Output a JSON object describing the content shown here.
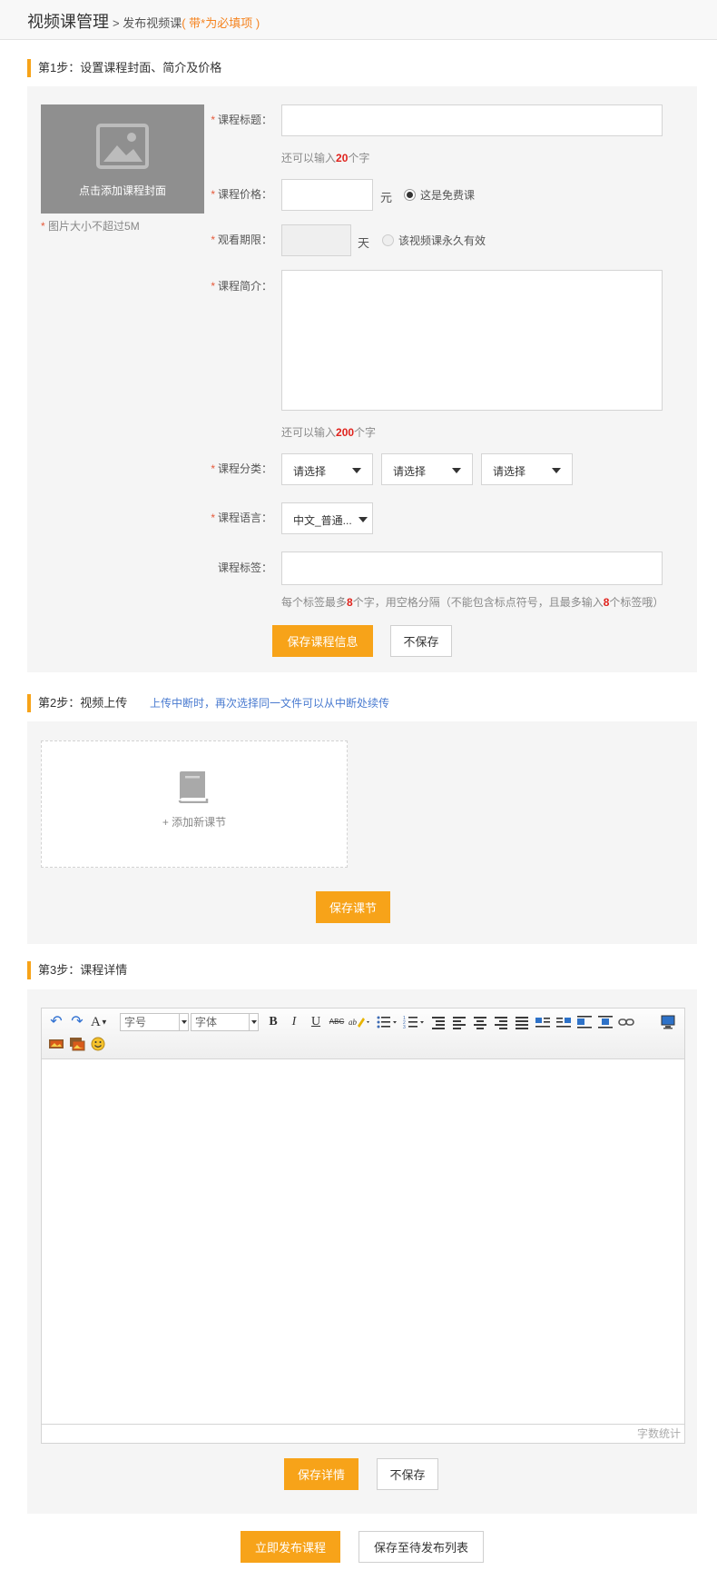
{
  "header": {
    "title": "视频课管理",
    "separator": ">",
    "crumb": "发布视频课",
    "required_note": "( 带*为必填项 )"
  },
  "step1": {
    "title": "第1步：设置课程封面、简介及价格",
    "cover": {
      "label": "点击添加课程封面",
      "note_star": "*",
      "note": "图片大小不超过5M"
    },
    "title_field": {
      "star": "*",
      "label": "课程标题：",
      "value": "",
      "hint_prefix": "还可以输入",
      "hint_count": "20",
      "hint_suffix": "个字"
    },
    "price_field": {
      "star": "*",
      "label": "课程价格：",
      "value": "",
      "unit": "元",
      "free_label": "这是免费课",
      "free_checked": true
    },
    "period_field": {
      "star": "*",
      "label": "观看期限：",
      "value": "",
      "unit": "天",
      "forever_label": "该视频课永久有效",
      "forever_checked": false
    },
    "intro_field": {
      "star": "*",
      "label": "课程简介：",
      "value": "",
      "hint_prefix": "还可以输入",
      "hint_count": "200",
      "hint_suffix": "个字"
    },
    "category_field": {
      "star": "*",
      "label": "课程分类：",
      "selects": [
        "请选择",
        "请选择",
        "请选择"
      ]
    },
    "language_field": {
      "star": "*",
      "label": "课程语言：",
      "selected": "中文_普通..."
    },
    "tags_field": {
      "label": "课程标签：",
      "value": "",
      "hint_a": "每个标签最多",
      "hint_n1": "8",
      "hint_b": "个字，用空格分隔（不能包含标点符号，且最多输入",
      "hint_n2": "8",
      "hint_c": "个标签哦）"
    },
    "save_label": "保存课程信息",
    "cancel_label": "不保存"
  },
  "step2": {
    "title": "第2步：视频上传",
    "note": "上传中断时，再次选择同一文件可以从中断处续传",
    "add_label": "+ 添加新课节",
    "save_label": "保存课节"
  },
  "step3": {
    "title": "第3步：课程详情",
    "toolbar": {
      "font_size_placeholder": "字号",
      "font_family_placeholder": "字体",
      "bold": "B",
      "italic": "I",
      "underline": "U",
      "strike": "ABC",
      "font_color": "A"
    },
    "word_count_label": "字数统计",
    "save_label": "保存详情",
    "cancel_label": "不保存"
  },
  "footer": {
    "publish_label": "立即发布课程",
    "save_pending_label": "保存至待发布列表"
  },
  "colors": {
    "accent": "#f7a319",
    "required": "#e65a3b",
    "count_red": "#e0221c",
    "note_blue": "#4a7bd0",
    "panel_bg": "#f5f5f5"
  }
}
